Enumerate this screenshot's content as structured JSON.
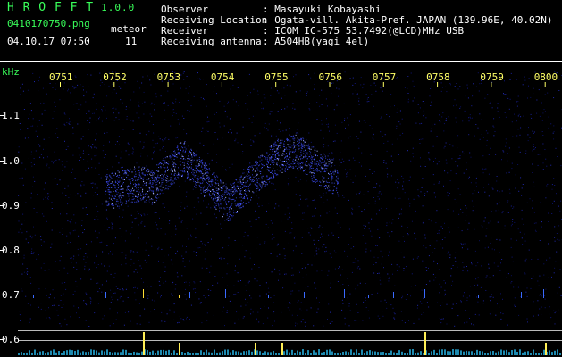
{
  "app": {
    "name": "H R O F F T",
    "version": "1.0.0"
  },
  "file": {
    "name": "0410170750.png",
    "datetime": "04.10.17 07:50"
  },
  "meteor": {
    "label": "meteor",
    "count": "11"
  },
  "info": [
    {
      "label": "Observer",
      "value": ": Masayuki Kobayashi"
    },
    {
      "label": "Receiving Location",
      "value": ": Ogata-vill. Akita-Pref. JAPAN (139.96E, 40.02N)"
    },
    {
      "label": "Receiver",
      "value": ": ICOM IC-575 53.7492(@LCD)MHz USB"
    },
    {
      "label": "Receiving antenna",
      "value": ": A504HB(yagi 4el)"
    }
  ],
  "axis": {
    "y_unit": "kHz",
    "y_ticks": [
      "1.1",
      "1.0",
      "0.9",
      "0.8",
      "0.7",
      "0.6"
    ],
    "x_ticks": [
      "0751",
      "0752",
      "0753",
      "0754",
      "0755",
      "0756",
      "0757",
      "0758",
      "0759",
      "0800"
    ]
  },
  "colors": {
    "label": "#39ff5a",
    "text": "#ffffff",
    "tick": "#ffff66",
    "bg": "#000000"
  }
}
